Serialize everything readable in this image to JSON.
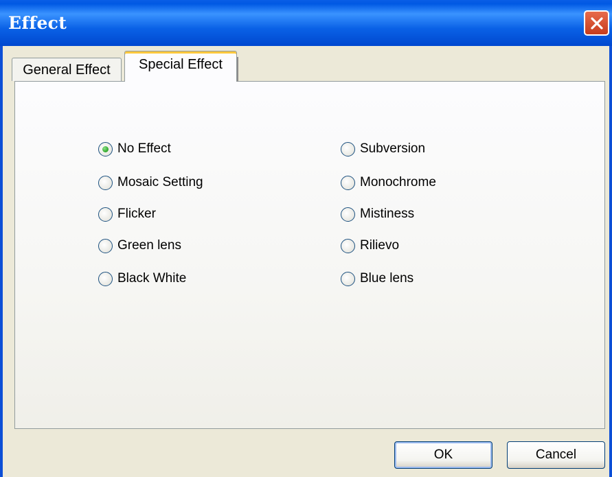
{
  "window": {
    "title": "Effect",
    "close_icon": "close-icon",
    "title_bar_color": "#0a5ee6",
    "close_color": "#d64a2a"
  },
  "tabs": [
    {
      "label": "General Effect",
      "selected": false
    },
    {
      "label": "Special Effect",
      "selected": true
    }
  ],
  "options": {
    "left": [
      {
        "label": "No Effect",
        "checked": true
      },
      {
        "label": "Mosaic Setting",
        "checked": false
      },
      {
        "label": "Flicker",
        "checked": false
      },
      {
        "label": "Green lens",
        "checked": false
      },
      {
        "label": "Black White",
        "checked": false
      }
    ],
    "right": [
      {
        "label": "Subversion",
        "checked": false
      },
      {
        "label": "Monochrome",
        "checked": false
      },
      {
        "label": "Mistiness",
        "checked": false
      },
      {
        "label": "Rilievo",
        "checked": false
      },
      {
        "label": "Blue lens",
        "checked": false
      }
    ]
  },
  "buttons": {
    "ok_label": "OK",
    "cancel_label": "Cancel"
  }
}
